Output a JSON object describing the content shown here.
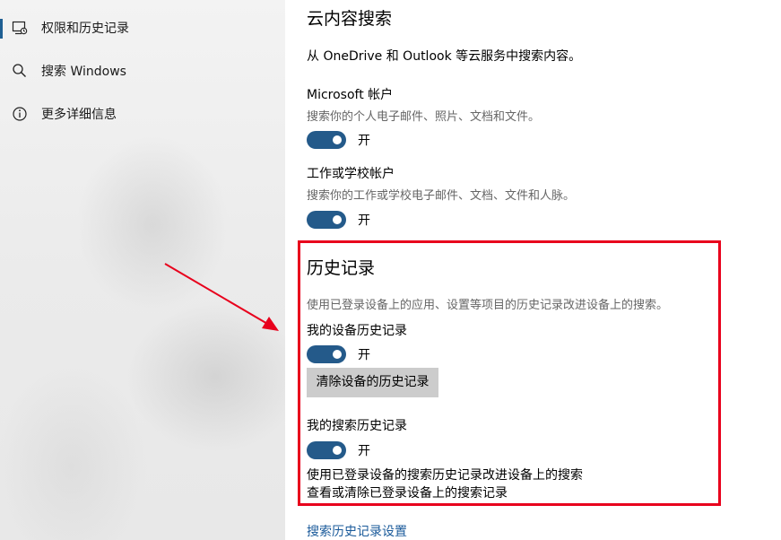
{
  "sidebar": {
    "items": [
      {
        "label": "权限和历史记录",
        "icon": "permissions-history-icon",
        "selected": true
      },
      {
        "label": "搜索 Windows",
        "icon": "search-icon",
        "selected": false
      },
      {
        "label": "更多详细信息",
        "icon": "info-icon",
        "selected": false
      }
    ]
  },
  "cloud_search": {
    "title": "云内容搜索",
    "description": "从 OneDrive 和 Outlook 等云服务中搜索内容。",
    "microsoft_account": {
      "title": "Microsoft 帐户",
      "subtitle": "搜索你的个人电子邮件、照片、文档和文件。",
      "toggle_state": "开"
    },
    "work_account": {
      "title": "工作或学校帐户",
      "subtitle": "搜索你的工作或学校电子邮件、文档、文件和人脉。",
      "toggle_state": "开"
    }
  },
  "history": {
    "title": "历史记录",
    "description": "使用已登录设备上的应用、设置等项目的历史记录改进设备上的搜索。",
    "device_history": {
      "title": "我的设备历史记录",
      "toggle_state": "开",
      "clear_button": "清除设备的历史记录"
    },
    "search_history": {
      "title": "我的搜索历史记录",
      "toggle_state": "开",
      "note_line1": "使用已登录设备的搜索历史记录改进设备上的搜索",
      "note_line2": "查看或清除已登录设备上的搜索记录"
    }
  },
  "footer_link": "搜索历史记录设置",
  "colors": {
    "accent": "#245a8a",
    "highlight": "#e8001c",
    "link": "#1a5a9a"
  }
}
